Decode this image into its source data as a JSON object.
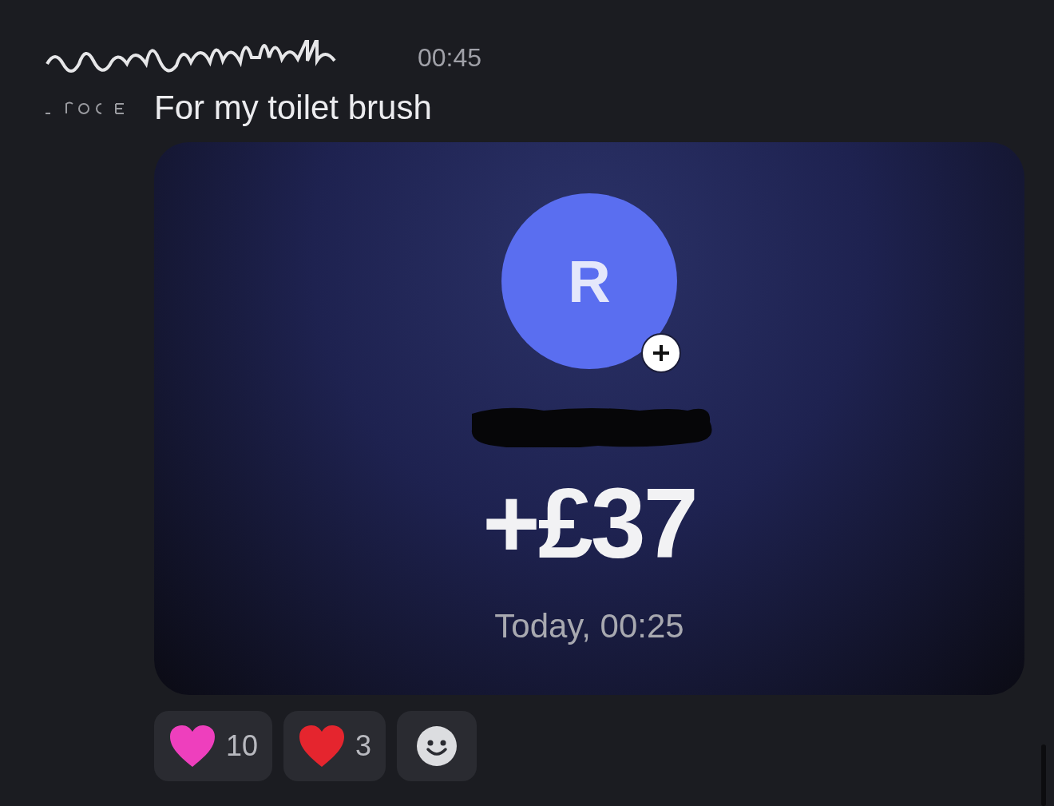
{
  "message": {
    "timestamp": "00:45",
    "text": "For my toilet brush",
    "attachment": {
      "avatar_letter": "R",
      "amount": "+£37",
      "date": "Today, 00:25"
    },
    "reactions": [
      {
        "kind": "emoji",
        "color": "#ee3fbd",
        "count": "10"
      },
      {
        "kind": "emoji",
        "color": "#e5252e",
        "count": "3"
      },
      {
        "kind": "add"
      }
    ]
  }
}
